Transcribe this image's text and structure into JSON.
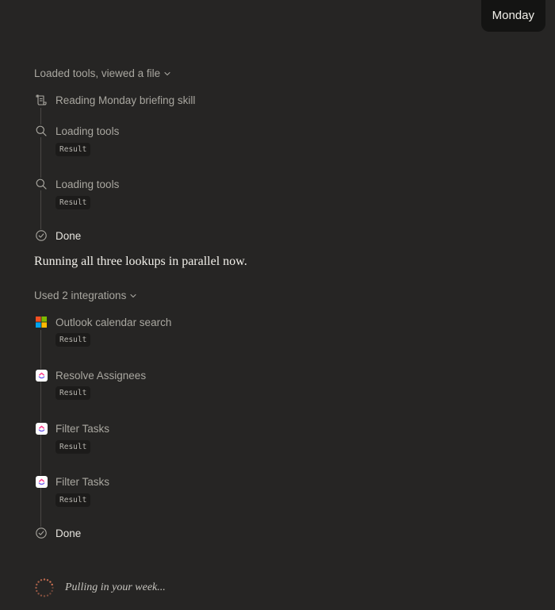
{
  "user_message": "Monday",
  "group1": {
    "summary": "Loaded tools, viewed a file",
    "steps": [
      {
        "icon": "scroll-icon",
        "label": "Reading Monday briefing skill"
      },
      {
        "icon": "search-icon",
        "label": "Loading tools",
        "result": "Result"
      },
      {
        "icon": "search-icon",
        "label": "Loading tools",
        "result": "Result"
      },
      {
        "icon": "check-circle-icon",
        "label": "Done"
      }
    ]
  },
  "assistant_message": "Running all three lookups in parallel now.",
  "group2": {
    "summary": "Used 2 integrations",
    "steps": [
      {
        "icon": "microsoft-icon",
        "label": "Outlook calendar search",
        "result": "Result"
      },
      {
        "icon": "clickup-icon",
        "label": "Resolve Assignees",
        "result": "Result"
      },
      {
        "icon": "clickup-icon",
        "label": "Filter Tasks",
        "result": "Result"
      },
      {
        "icon": "clickup-icon",
        "label": "Filter Tasks",
        "result": "Result"
      },
      {
        "icon": "check-circle-icon",
        "label": "Done"
      }
    ]
  },
  "status": {
    "icon": "loading-spinner-icon",
    "text": "Pulling in your week..."
  },
  "colors": {
    "background": "#262524",
    "spinner": "#d97757"
  }
}
